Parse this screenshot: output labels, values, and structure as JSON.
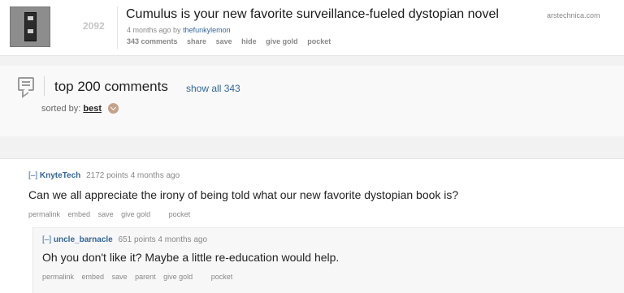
{
  "post": {
    "score": "2092",
    "title": "Cumulus is your new favorite surveillance-fueled dystopian novel",
    "domain": "arstechnica.com",
    "submitted_prefix": "4 months ago by",
    "author": "thefunkylemon",
    "buttons": [
      "343 comments",
      "share",
      "save",
      "hide",
      "give gold",
      "pocket"
    ]
  },
  "comments_header": {
    "title": "top 200 comments",
    "show_all": "show all 343",
    "sorted_label": "sorted by:",
    "sorted_value": "best"
  },
  "comments": [
    {
      "expand": "[–]",
      "user": "KnyteTech",
      "meta": "2172 points 4 months ago",
      "body": "Can we all appreciate the irony of being told what our new favorite dystopian book is?",
      "buttons": [
        "permalink",
        "embed",
        "save",
        "give gold",
        "pocket"
      ]
    },
    {
      "expand": "[–]",
      "user": "uncle_barnacle",
      "meta": "651 points 4 months ago",
      "body": "Oh you don't like it? Maybe a little re-education would help.",
      "buttons": [
        "permalink",
        "embed",
        "save",
        "parent",
        "give gold",
        "pocket"
      ]
    }
  ]
}
